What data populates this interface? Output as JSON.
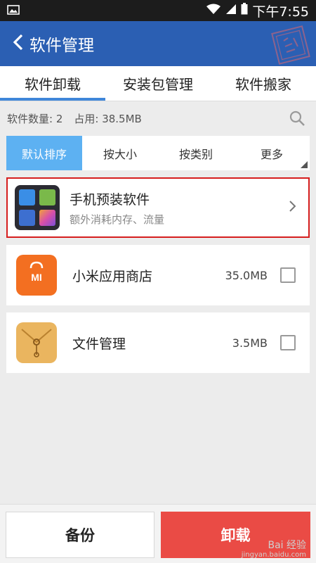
{
  "status_bar": {
    "time": "下午7:55",
    "icons": [
      "image-icon",
      "wifi-icon",
      "signal-icon",
      "battery-icon"
    ]
  },
  "app_bar": {
    "title": "软件管理",
    "back_icon": "back-arrow-icon"
  },
  "tabs": [
    {
      "label": "软件卸载",
      "active": true
    },
    {
      "label": "安装包管理",
      "active": false
    },
    {
      "label": "软件搬家",
      "active": false
    }
  ],
  "summary": {
    "count_text": "软件数量: 2",
    "used_text": "占用: 38.5MB"
  },
  "sort_options": [
    {
      "label": "默认排序",
      "active": true
    },
    {
      "label": "按大小",
      "active": false
    },
    {
      "label": "按类别",
      "active": false
    },
    {
      "label": "更多",
      "active": false
    }
  ],
  "preinstalled": {
    "title": "手机预装软件",
    "subtitle": "额外消耗内存、流量"
  },
  "apps": [
    {
      "name": "小米应用商店",
      "size": "35.0MB",
      "icon": "mi-store-icon",
      "checked": false
    },
    {
      "name": "文件管理",
      "size": "3.5MB",
      "icon": "file-manager-icon",
      "checked": false
    }
  ],
  "buttons": {
    "backup": "备份",
    "uninstall": "卸载"
  },
  "watermark": {
    "brand": "Bai 经验",
    "url": "jingyan.baidu.com"
  },
  "colors": {
    "app_bar": "#2b5fb3",
    "active_sort": "#5db1f2",
    "tab_indicator": "#3f86d9",
    "uninstall": "#ea4b45",
    "highlight_border": "#d61e1e"
  }
}
